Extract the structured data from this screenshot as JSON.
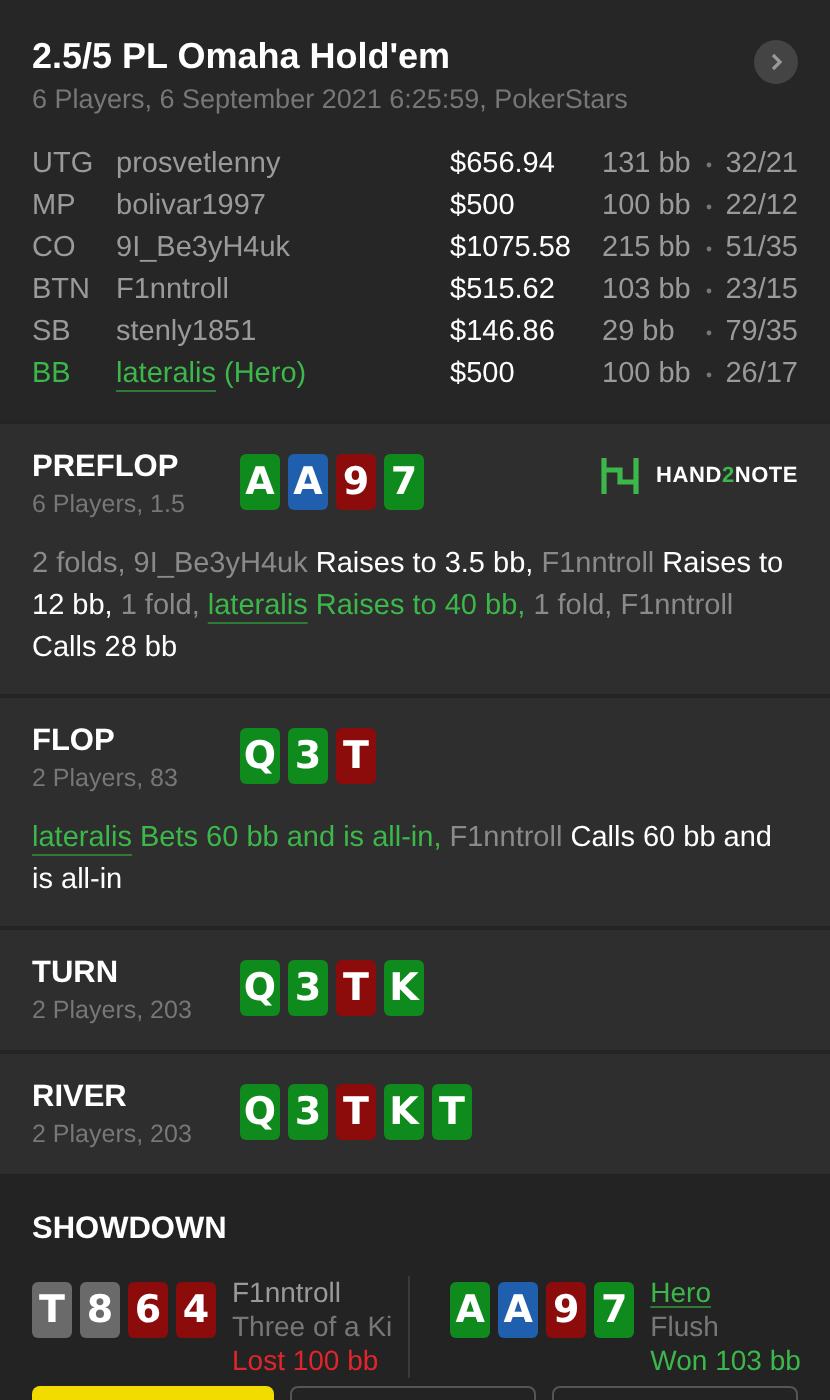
{
  "header": {
    "title": "2.5/5 PL Omaha Hold'em",
    "subtitle": "6 Players, 6 September 2021 6:25:59, PokerStars"
  },
  "players": [
    {
      "position": "UTG",
      "name": "prosvetlenny",
      "stack": "$656.94",
      "bb": "131 bb",
      "stats": "32/21",
      "hero": false
    },
    {
      "position": "MP",
      "name": "bolivar1997",
      "stack": "$500",
      "bb": "100 bb",
      "stats": "22/12",
      "hero": false
    },
    {
      "position": "CO",
      "name": "9I_Be3yH4uk",
      "stack": "$1075.58",
      "bb": "215 bb",
      "stats": "51/35",
      "hero": false
    },
    {
      "position": "BTN",
      "name": "F1nntroll",
      "stack": "$515.62",
      "bb": "103 bb",
      "stats": "23/15",
      "hero": false
    },
    {
      "position": "SB",
      "name": "stenly1851",
      "stack": "$146.86",
      "bb": "29 bb",
      "stats": "79/35",
      "hero": false
    },
    {
      "position": "BB",
      "name": "lateralis",
      "suffix": " (Hero)",
      "stack": "$500",
      "bb": "100 bb",
      "stats": "26/17",
      "hero": true
    }
  ],
  "streets": [
    {
      "name": "PREFLOP",
      "info": "6 Players, 1.5",
      "logo": {
        "mark_left": "HAND",
        "mark_mid": "2",
        "mark_right": "NOTE"
      },
      "cards": [
        {
          "rank": "A",
          "color": "#0f8a1d"
        },
        {
          "rank": "A",
          "color": "#1f5fad"
        },
        {
          "rank": "9",
          "color": "#8c0c0c"
        },
        {
          "rank": "7",
          "color": "#0f8a1d"
        }
      ],
      "actions": [
        {
          "kind": "muted",
          "text": "2 folds, "
        },
        {
          "kind": "muted",
          "text": "9I_Be3yH4uk"
        },
        {
          "kind": "plain",
          "text": " Raises to 3.5 bb, "
        },
        {
          "kind": "muted",
          "text": "F1nntroll"
        },
        {
          "kind": "plain",
          "text": " Raises to 12 bb, "
        },
        {
          "kind": "muted",
          "text": "1 fold, "
        },
        {
          "kind": "hero",
          "text": "lateralis"
        },
        {
          "kind": "green",
          "text": " Raises to 40 bb, "
        },
        {
          "kind": "muted",
          "text": "1 fold, "
        },
        {
          "kind": "muted",
          "text": "F1nntroll"
        },
        {
          "kind": "plain",
          "text": " Calls 28 bb"
        }
      ]
    },
    {
      "name": "FLOP",
      "info": "2 Players, 83",
      "cards": [
        {
          "rank": "Q",
          "color": "#0f8a1d"
        },
        {
          "rank": "3",
          "color": "#0f8a1d"
        },
        {
          "rank": "T",
          "color": "#8c0c0c"
        }
      ],
      "actions": [
        {
          "kind": "hero",
          "text": "lateralis"
        },
        {
          "kind": "green",
          "text": " Bets 60 bb and is all-in, "
        },
        {
          "kind": "muted",
          "text": "F1nntroll"
        },
        {
          "kind": "plain",
          "text": " Calls 60 bb and is all-in"
        }
      ]
    },
    {
      "name": "TURN",
      "info": "2 Players, 203",
      "cards": [
        {
          "rank": "Q",
          "color": "#0f8a1d"
        },
        {
          "rank": "3",
          "color": "#0f8a1d"
        },
        {
          "rank": "T",
          "color": "#8c0c0c"
        },
        {
          "rank": "K",
          "color": "#0f8a1d"
        }
      ]
    },
    {
      "name": "RIVER",
      "info": "2 Players, 203",
      "cards": [
        {
          "rank": "Q",
          "color": "#0f8a1d"
        },
        {
          "rank": "3",
          "color": "#0f8a1d"
        },
        {
          "rank": "T",
          "color": "#8c0c0c"
        },
        {
          "rank": "K",
          "color": "#0f8a1d"
        },
        {
          "rank": "T",
          "color": "#0f8a1d"
        }
      ]
    }
  ],
  "showdown": {
    "title": "SHOWDOWN",
    "hands": [
      {
        "name": "F1nntroll",
        "hero": false,
        "hand": "Three of a Ki",
        "result": "Lost 100 bb",
        "won": false,
        "cards": [
          {
            "rank": "T",
            "color": "#6a6a6a"
          },
          {
            "rank": "8",
            "color": "#6a6a6a"
          },
          {
            "rank": "6",
            "color": "#8c0c0c"
          },
          {
            "rank": "4",
            "color": "#8c0c0c"
          }
        ]
      },
      {
        "name": "Hero",
        "hero": true,
        "hand": "Flush",
        "result": "Won 103 bb",
        "won": true,
        "cards": [
          {
            "rank": "A",
            "color": "#0f8a1d"
          },
          {
            "rank": "A",
            "color": "#1f5fad"
          },
          {
            "rank": "9",
            "color": "#8c0c0c"
          },
          {
            "rank": "7",
            "color": "#0f8a1d"
          }
        ]
      }
    ]
  },
  "bottom_buttons": [
    {
      "kind": "primary"
    },
    {
      "kind": "outline"
    },
    {
      "kind": "outline"
    }
  ]
}
